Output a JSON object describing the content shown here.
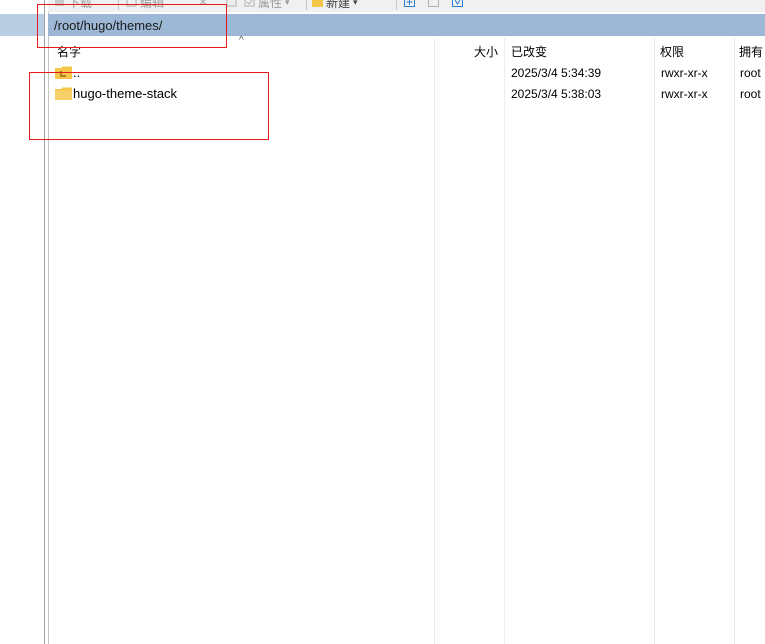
{
  "toolbar": {
    "download_label": "下载",
    "edit_label": "编辑",
    "properties_label": "属性",
    "new_label": "新建"
  },
  "path": {
    "value": "/root/hugo/themes/"
  },
  "columns": {
    "name": "名字",
    "size": "大小",
    "modified": "已改变",
    "permissions": "权限",
    "owner": "拥有"
  },
  "files": [
    {
      "name": "..",
      "icon": "parent-folder-icon",
      "size": "",
      "modified": "2025/3/4 5:34:39",
      "permissions": "rwxr-xr-x",
      "owner": "root"
    },
    {
      "name": "hugo-theme-stack",
      "icon": "folder-icon",
      "size": "",
      "modified": "2025/3/4 5:38:03",
      "permissions": "rwxr-xr-x",
      "owner": "root"
    }
  ],
  "colors": {
    "path_bar": "#9cb8d6",
    "annotation_red": "#e8191c",
    "folder_yellow": "#f4c74a"
  }
}
